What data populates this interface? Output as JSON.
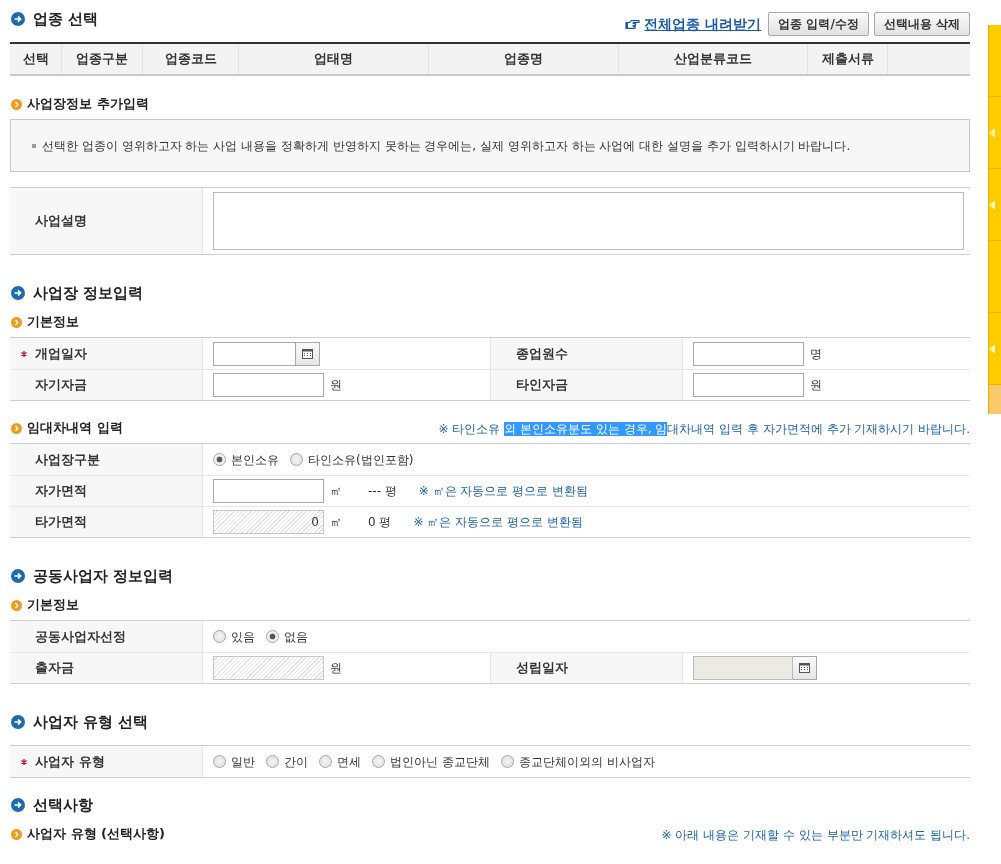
{
  "industry": {
    "title": "업종 선택",
    "download_link": "전체업종 내려받기",
    "buttons": [
      "업종 입력/수정",
      "선택내용 삭제"
    ],
    "columns": [
      "선택",
      "업종구분",
      "업종코드",
      "업태명",
      "업종명",
      "산업분류코드",
      "제출서류"
    ]
  },
  "blocks": [
    {
      "kind": "subheading",
      "title": "사업장정보 추가입력"
    },
    {
      "kind": "notice_box",
      "text": "선택한 업종이 영위하고자 하는 사업 내용을 정확하게 반영하지 못하는 경우에는, 실제 영위하고자 하는 사업에 대한 설명을 추가 입력하시기 바랍니다."
    },
    {
      "kind": "form",
      "rows": [
        {
          "cells": [
            {
              "label": "사업설명",
              "required": false,
              "controls": [
                {
                  "kind": "textarea"
                }
              ]
            }
          ]
        }
      ]
    },
    {
      "kind": "heading",
      "title": "사업장 정보입력"
    },
    {
      "kind": "subheading",
      "title": "기본정보"
    },
    {
      "kind": "form",
      "rows": [
        {
          "cells": [
            {
              "label": "개업일자",
              "required": true,
              "controls": [
                {
                  "kind": "date",
                  "disabled": false
                }
              ]
            },
            {
              "label": "종업원수",
              "required": false,
              "controls": [
                {
                  "kind": "input",
                  "disabled": false
                },
                {
                  "kind": "unit",
                  "text": "명"
                }
              ]
            }
          ]
        },
        {
          "cells": [
            {
              "label": "자기자금",
              "required": false,
              "controls": [
                {
                  "kind": "input",
                  "disabled": false
                },
                {
                  "kind": "unit",
                  "text": "원"
                }
              ]
            },
            {
              "label": "타인자금",
              "required": false,
              "controls": [
                {
                  "kind": "input",
                  "disabled": false
                },
                {
                  "kind": "unit",
                  "text": "원"
                }
              ]
            }
          ]
        }
      ]
    },
    {
      "kind": "subheading",
      "title": "임대차내역 입력",
      "notice": [
        {
          "text": "※ 타인소유 ",
          "selected": false
        },
        {
          "text": "외 본인소유분도 있는 경우, 임",
          "selected": true
        },
        {
          "text": "대차내역 입력 후 자가면적에 추가 기재하시기 바랍니다.",
          "selected": false
        }
      ]
    },
    {
      "kind": "form",
      "rows": [
        {
          "cells": [
            {
              "label": "사업장구분",
              "required": false,
              "controls": [
                {
                  "kind": "radio_group",
                  "options": [
                    {
                      "label": "본인소유",
                      "selected": true
                    },
                    {
                      "label": "타인소유(법인포함)",
                      "selected": false
                    }
                  ]
                }
              ]
            }
          ]
        },
        {
          "cells": [
            {
              "label": "자가면적",
              "required": false,
              "controls": [
                {
                  "kind": "input",
                  "disabled": false
                },
                {
                  "kind": "unit",
                  "text": "㎡"
                },
                {
                  "kind": "unit",
                  "text": "--- 평"
                },
                {
                  "kind": "note",
                  "text": "※ ㎡은 자동으로 평으로 변환됨"
                }
              ]
            }
          ]
        },
        {
          "cells": [
            {
              "label": "타가면적",
              "required": false,
              "controls": [
                {
                  "kind": "input",
                  "disabled": true,
                  "value": "0"
                },
                {
                  "kind": "unit",
                  "text": "㎡"
                },
                {
                  "kind": "unit",
                  "text": "0 평"
                },
                {
                  "kind": "note",
                  "text": "※ ㎡은 자동으로 평으로 변환됨"
                }
              ]
            }
          ]
        }
      ]
    },
    {
      "kind": "heading",
      "title": "공동사업자 정보입력"
    },
    {
      "kind": "subheading",
      "title": "기본정보"
    },
    {
      "kind": "form",
      "rows": [
        {
          "cells": [
            {
              "label": "공동사업자선정",
              "required": false,
              "controls": [
                {
                  "kind": "radio_group",
                  "options": [
                    {
                      "label": "있음",
                      "selected": false
                    },
                    {
                      "label": "없음",
                      "selected": true
                    }
                  ]
                }
              ]
            }
          ]
        },
        {
          "cells": [
            {
              "label": "출자금",
              "required": false,
              "controls": [
                {
                  "kind": "input",
                  "disabled": true
                },
                {
                  "kind": "unit",
                  "text": "원"
                }
              ]
            },
            {
              "label": "성립일자",
              "required": false,
              "controls": [
                {
                  "kind": "date",
                  "disabled": true
                }
              ]
            }
          ]
        }
      ]
    },
    {
      "kind": "heading",
      "title": "사업자 유형 선택"
    },
    {
      "kind": "form",
      "rows": [
        {
          "cells": [
            {
              "label": "사업자 유형",
              "required": true,
              "controls": [
                {
                  "kind": "radio_group",
                  "options": [
                    {
                      "label": "일반",
                      "selected": false
                    },
                    {
                      "label": "간이",
                      "selected": false
                    },
                    {
                      "label": "면세",
                      "selected": false
                    },
                    {
                      "label": "법인아닌 종교단체",
                      "selected": false
                    },
                    {
                      "label": "종교단체이외의 비사업자",
                      "selected": false
                    }
                  ]
                }
              ]
            }
          ]
        }
      ]
    },
    {
      "kind": "heading",
      "title": "선택사항"
    },
    {
      "kind": "subheading",
      "title": "사업자 유형 (선택사항)",
      "notice": [
        {
          "text": "※ 아래 내용은 기재할 수 있는 부분만 기재하셔도 됩니다.",
          "selected": false
        }
      ]
    }
  ],
  "side_tabs": [
    {
      "selected": false,
      "arrow": false
    },
    {
      "selected": false,
      "arrow": true
    },
    {
      "selected": false,
      "arrow": true
    },
    {
      "selected": false,
      "arrow": false
    },
    {
      "selected": false,
      "arrow": true
    },
    {
      "selected": true,
      "arrow": false
    }
  ]
}
